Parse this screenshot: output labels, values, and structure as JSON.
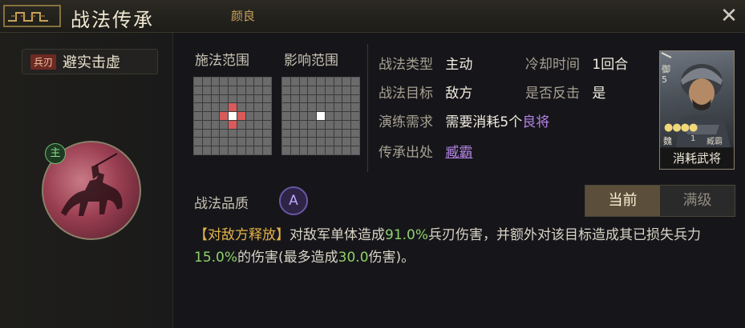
{
  "header": {
    "title": "战法传承",
    "subtitle": "颜良",
    "close_icon": "close-icon"
  },
  "skill": {
    "type_tag": "兵刃",
    "name": "避实击虚",
    "main_badge": "主"
  },
  "ranges": {
    "cast_label": "施法范围",
    "effect_label": "影响范围",
    "cast_grid": {
      "rows": 9,
      "cols": 9,
      "center": [
        4,
        4
      ],
      "red_cells": [
        [
          3,
          4
        ],
        [
          5,
          4
        ],
        [
          4,
          3
        ],
        [
          4,
          5
        ]
      ]
    },
    "effect_grid": {
      "rows": 9,
      "cols": 9,
      "center": [
        4,
        4
      ],
      "red_cells": []
    }
  },
  "info": {
    "type_label": "战法类型",
    "type_value": "主动",
    "cooldown_label": "冷却时间",
    "cooldown_value": "1回合",
    "target_label": "战法目标",
    "target_value": "敌方",
    "counter_label": "是否反击",
    "counter_value": "是",
    "practice_label": "演练需求",
    "practice_prefix": "需要消耗5个",
    "practice_highlight": "良将",
    "origin_label": "传承出处",
    "origin_value": "臧霸"
  },
  "hero_card": {
    "tag_line1": "御",
    "tag_line2": "5",
    "coins": "●●●●",
    "faction": "魏",
    "level": "1",
    "name": "臧霸",
    "caption": "消耗武将"
  },
  "quality": {
    "label": "战法品质",
    "grade": "A"
  },
  "tabs": {
    "current": "当前",
    "max": "满级"
  },
  "description": {
    "tag": "【对敌方释放】",
    "part1": "对敌军单体造成",
    "value1": "91.0%",
    "part2": "兵刃伤害，并额外对该目标造成其已损失兵力",
    "value2": "15.0%",
    "part3": "的伤害(最多造成",
    "value3": "30.0",
    "part4": "伤害)。"
  },
  "colors": {
    "accent_gold": "#c9a25b",
    "highlight_yellow": "#e4b24a",
    "highlight_green": "#8fd06b",
    "purple": "#b483e6",
    "grid_red": "#d85a5a"
  }
}
